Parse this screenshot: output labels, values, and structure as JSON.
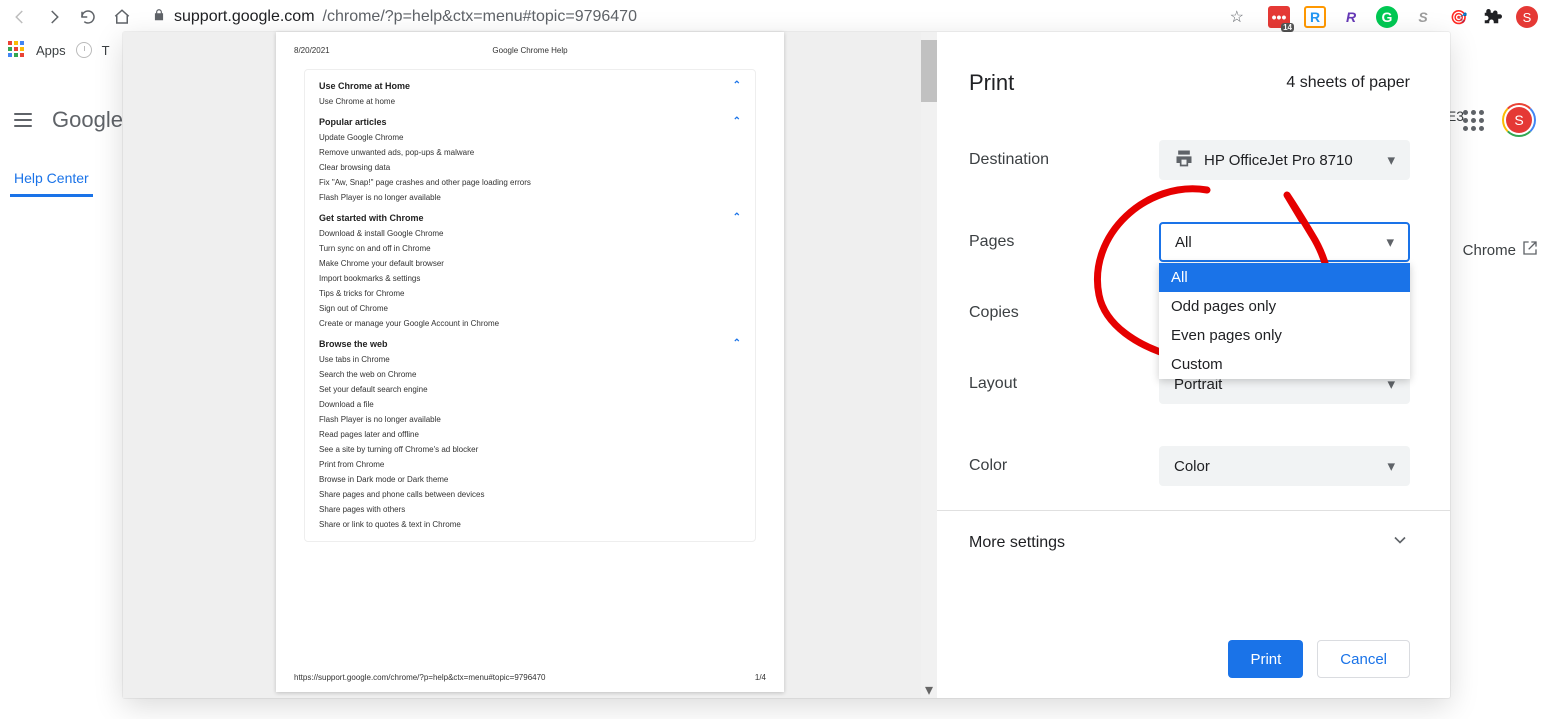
{
  "toolbar": {
    "url_host": "support.google.com",
    "url_path": "/chrome/?p=help&ctx=menu#topic=9796470",
    "ext_badge": "14"
  },
  "bookmarks": {
    "apps": "Apps",
    "right_e3": "E3",
    "chrome_btn": "Chrome"
  },
  "bg": {
    "brand": "Google",
    "tab": "Help Center",
    "avatar": "S"
  },
  "preview": {
    "date": "8/20/2021",
    "title": "Google Chrome Help",
    "footer_url": "https://support.google.com/chrome/?p=help&ctx=menu#topic=9796470",
    "footer_page": "1/4",
    "sections": {
      "s0": {
        "title": "Use Chrome at Home",
        "items": {
          "i0": "Use Chrome at home"
        }
      },
      "s1": {
        "title": "Popular articles",
        "items": {
          "i0": "Update Google Chrome",
          "i1": "Remove unwanted ads, pop-ups & malware",
          "i2": "Clear browsing data",
          "i3": "Fix \"Aw, Snap!\" page crashes and other page loading errors",
          "i4": "Flash Player is no longer available"
        }
      },
      "s2": {
        "title": "Get started with Chrome",
        "items": {
          "i0": "Download & install Google Chrome",
          "i1": "Turn sync on and off in Chrome",
          "i2": "Make Chrome your default browser",
          "i3": "Import bookmarks & settings",
          "i4": "Tips & tricks for Chrome",
          "i5": "Sign out of Chrome",
          "i6": "Create or manage your Google Account in Chrome"
        }
      },
      "s3": {
        "title": "Browse the web",
        "items": {
          "i0": "Use tabs in Chrome",
          "i1": "Search the web on Chrome",
          "i2": "Set your default search engine",
          "i3": "Download a file",
          "i4": "Flash Player is no longer available",
          "i5": "Read pages later and offline",
          "i6": "See a site by turning off Chrome's ad blocker",
          "i7": "Print from Chrome",
          "i8": "Browse in Dark mode or Dark theme",
          "i9": "Share pages and phone calls between devices",
          "i10": "Share pages with others",
          "i11": "Share or link to quotes & text in Chrome"
        }
      }
    }
  },
  "panel": {
    "title": "Print",
    "sheets": "4 sheets of paper",
    "destination_label": "Destination",
    "destination_value": "HP OfficeJet Pro 8710",
    "pages_label": "Pages",
    "pages_value": "All",
    "pages_options": {
      "o0": "All",
      "o1": "Odd pages only",
      "o2": "Even pages only",
      "o3": "Custom"
    },
    "copies_label": "Copies",
    "layout_label": "Layout",
    "layout_value": "Portrait",
    "color_label": "Color",
    "color_value": "Color",
    "more": "More settings",
    "btn_print": "Print",
    "btn_cancel": "Cancel"
  }
}
